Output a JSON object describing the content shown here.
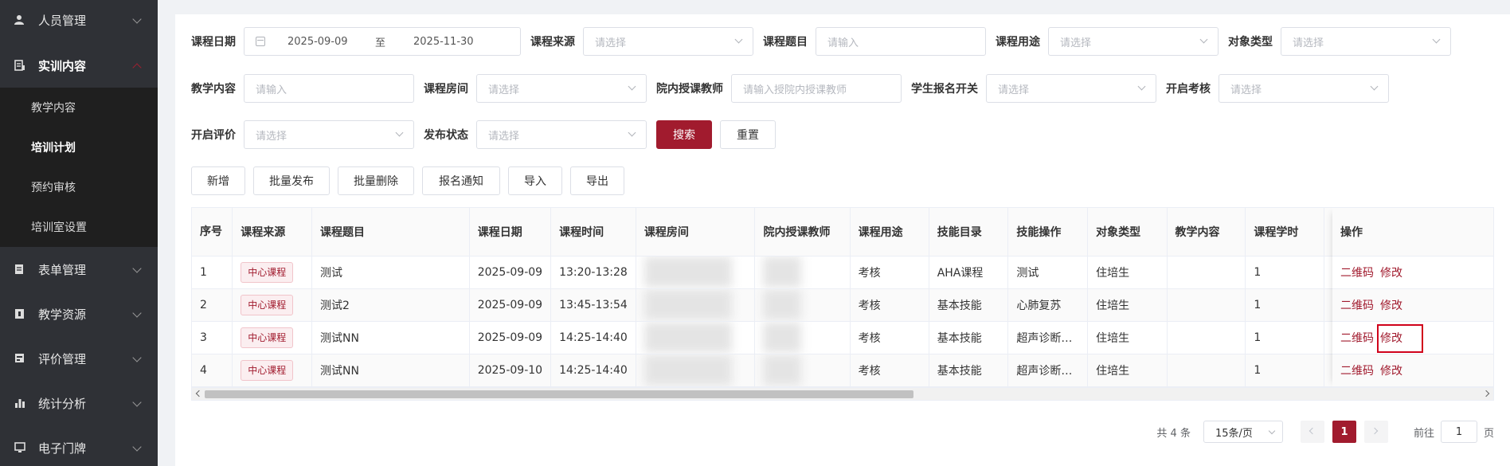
{
  "sidebar": {
    "menus": [
      {
        "label": "人员管理",
        "icon": "user-icon"
      },
      {
        "label": "实训内容",
        "icon": "book-icon"
      },
      {
        "label": "表单管理",
        "icon": "form-icon"
      },
      {
        "label": "教学资源",
        "icon": "resource-icon"
      },
      {
        "label": "评价管理",
        "icon": "evaluate-icon"
      },
      {
        "label": "统计分析",
        "icon": "chart-icon"
      },
      {
        "label": "电子门牌",
        "icon": "monitor-icon"
      }
    ],
    "sub_items": [
      {
        "label": "教学内容"
      },
      {
        "label": "培训计划"
      },
      {
        "label": "预约审核"
      },
      {
        "label": "培训室设置"
      }
    ]
  },
  "filters": {
    "course_date": {
      "label": "课程日期",
      "start": "2025-09-09",
      "sep": "至",
      "end": "2025-11-30"
    },
    "course_source": {
      "label": "课程来源",
      "placeholder": "请选择"
    },
    "course_title": {
      "label": "课程题目",
      "placeholder": "请输入"
    },
    "course_use": {
      "label": "课程用途",
      "placeholder": "请选择"
    },
    "target_type": {
      "label": "对象类型",
      "placeholder": "请选择"
    },
    "teaching_content": {
      "label": "教学内容",
      "placeholder": "请输入"
    },
    "course_room": {
      "label": "课程房间",
      "placeholder": "请选择"
    },
    "internal_teacher": {
      "label": "院内授课教师",
      "placeholder": "请输入授院内授课教师"
    },
    "signup_switch": {
      "label": "学生报名开关",
      "placeholder": "请选择"
    },
    "open_exam": {
      "label": "开启考核",
      "placeholder": "请选择"
    },
    "open_eval": {
      "label": "开启评价",
      "placeholder": "请选择"
    },
    "publish_status": {
      "label": "发布状态",
      "placeholder": "请选择"
    },
    "search_btn": "搜索",
    "reset_btn": "重置"
  },
  "actions": {
    "add": "新增",
    "batch_publish": "批量发布",
    "batch_delete": "批量删除",
    "signup_notice": "报名通知",
    "import": "导入",
    "export": "导出"
  },
  "table": {
    "headers": {
      "seq": "序号",
      "source": "课程来源",
      "title": "课程题目",
      "date": "课程日期",
      "time": "课程时间",
      "room": "课程房间",
      "teacher": "院内授课教师",
      "use": "课程用途",
      "skill_dir": "技能目录",
      "skill_op": "技能操作",
      "target": "对象类型",
      "content": "教学内容",
      "hours": "课程学时",
      "ops": "操作"
    },
    "rows": [
      {
        "seq": "1",
        "source": "中心课程",
        "title": "测试",
        "date": "2025-09-09",
        "time": "13:20-13:28",
        "use": "考核",
        "skill_dir": "AHA课程",
        "skill_op": "测试",
        "target": "住培生",
        "content": "",
        "hours": "1",
        "qr": "二维码",
        "edit": "修改"
      },
      {
        "seq": "2",
        "source": "中心课程",
        "title": "测试2",
        "date": "2025-09-09",
        "time": "13:45-13:54",
        "use": "考核",
        "skill_dir": "基本技能",
        "skill_op": "心肺复苏",
        "target": "住培生",
        "content": "",
        "hours": "1",
        "qr": "二维码",
        "edit": "修改"
      },
      {
        "seq": "3",
        "source": "中心课程",
        "title": "测试NN",
        "date": "2025-09-09",
        "time": "14:25-14:40",
        "use": "考核",
        "skill_dir": "基本技能",
        "skill_op": "超声诊断…",
        "target": "住培生",
        "content": "",
        "hours": "1",
        "qr": "二维码",
        "edit": "修改"
      },
      {
        "seq": "4",
        "source": "中心课程",
        "title": "测试NN",
        "date": "2025-09-10",
        "time": "14:25-14:40",
        "use": "考核",
        "skill_dir": "基本技能",
        "skill_op": "超声诊断…",
        "target": "住培生",
        "content": "",
        "hours": "1",
        "qr": "二维码",
        "edit": "修改"
      }
    ]
  },
  "pagination": {
    "total": "共 4 条",
    "page_size": "15条/页",
    "current": "1",
    "goto_label": "前往",
    "goto_value": "1",
    "page_unit": "页"
  },
  "colors": {
    "primary": "#a11b2e",
    "sidebar_bg": "#2f3136"
  }
}
